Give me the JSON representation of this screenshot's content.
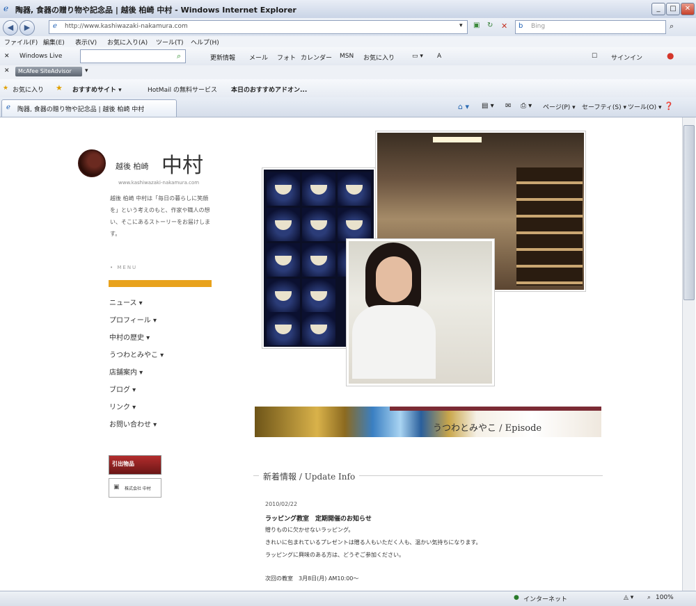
{
  "window": {
    "title": "陶器, 食器の贈り物や記念品 | 越後 柏崎 中村 - Windows Internet Explorer"
  },
  "address_bar": {
    "url": "http://www.kashiwazaki-nakamura.com",
    "search_placeholder": "Bing"
  },
  "menu": [
    "ファイル(F)",
    "編集(E)",
    "表示(V)",
    "お気に入り(A)",
    "ツール(T)",
    "ヘルプ(H)"
  ],
  "live_toolbar": {
    "brand": "Windows Live",
    "items": [
      "更新情報",
      "メール",
      "フォト",
      "カレンダー",
      "MSN",
      "お気に入り"
    ],
    "signin": "サインイン"
  },
  "mcafee": {
    "label": "McAfee SiteAdvisor"
  },
  "favorites_bar": {
    "favorites": "お気に入り",
    "items": [
      "おすすめサイト ▾",
      "HotMail の無料サービス",
      "本日のおすすめアドオン..."
    ]
  },
  "tab": {
    "title": "陶器, 食器の贈り物や記念品 | 越後 柏崎 中村"
  },
  "command_bar": {
    "items": [
      "ページ(P) ▾",
      "セーフティ(S) ▾",
      "ツール(O) ▾"
    ]
  },
  "status_bar": {
    "zone": "インターネット",
    "zoom": "100%"
  },
  "site": {
    "logo_sub": "越後 柏崎",
    "logo_main": "中村",
    "logo_url": "www.kashiwazaki-nakamura.com",
    "intro": "越後 柏崎 中村は「毎日の暮らしに笑顔を」という考えのもと、作家や職人の想い、そこにあるストーリーをお届けします。",
    "menu_heading": "• MENU",
    "nav": [
      "ニュース ▾",
      "プロフィール ▾",
      "中村の歴史 ▾",
      "うつわとみやこ ▾",
      "店舗案内 ▾",
      "ブログ ▾",
      "リンク ▾",
      "お問い合わせ ▾"
    ],
    "banner1": "引出物品",
    "banner2": "株式会社 中村",
    "episode": "うつわとみやこ / Episode",
    "update_title": "新着情報 / Update Info",
    "news": {
      "date": "2010/02/22",
      "headline": "ラッピング教室　定期開催のお知らせ",
      "lines": [
        "贈りものに欠かせないラッピング。",
        "きれいに包まれているプレゼントは贈る人もいただく人も、温かい気持ちになります。",
        "ラッピングに興味のある方は、どうぞご参加ください。"
      ],
      "next": "次回の教室　3月8日(月) AM10:00〜"
    }
  }
}
